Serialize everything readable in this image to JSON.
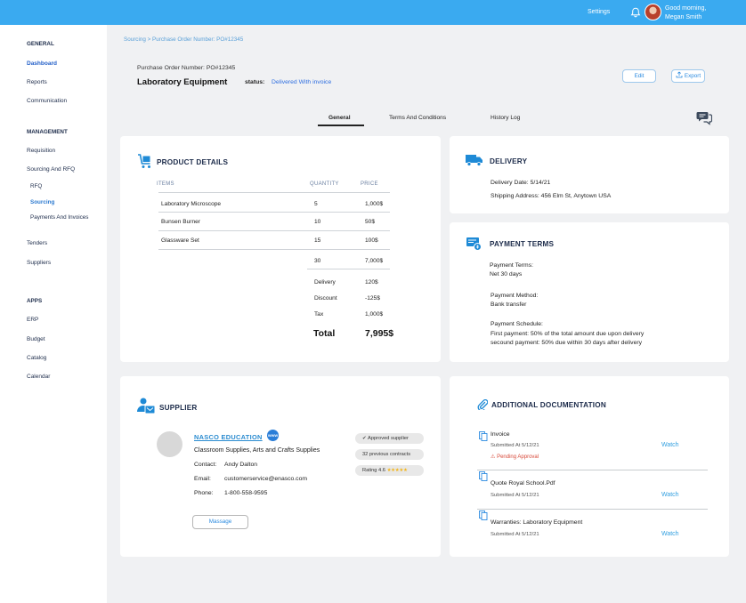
{
  "header": {
    "settings": "Settings",
    "greeting_line1": "Good morning,",
    "greeting_line2": "Megan Smith"
  },
  "sidebar": {
    "general": "GENERAL",
    "dashboard": "Dashboard",
    "reports": "Reports",
    "communication": "Communication",
    "management": "MANAGEMENT",
    "requisition": "Requisition",
    "sourcing_rfq": "Sourcing And RFQ",
    "rfq": "RFQ",
    "sourcing": "Sourcing",
    "payments": "Payments And Invoices",
    "tenders": "Tenders",
    "suppliers": "Suppliers",
    "apps": "APPS",
    "erp": "ERP",
    "budget": "Budget",
    "catalog": "Catalog",
    "calendar": "Calendar"
  },
  "breadcrumb": "Sourcing >  Purchase Order Number: PO#12345",
  "po_label": "Purchase Order Number: PO#12345",
  "title": "Laboratory Equipment",
  "status_label": "status:",
  "status_value": "Delivered With invoice",
  "buttons": {
    "edit": "Edit",
    "export": "Export",
    "message": "Massage"
  },
  "tabs": [
    "General",
    "Terms And Conditions",
    "History Log"
  ],
  "product": {
    "title": "PRODUCT DETAILS",
    "headers": [
      "ITEMS",
      "QUANTITY",
      "PRICE"
    ],
    "rows": [
      [
        "Laboratory Microscope",
        "5",
        "1,000$"
      ],
      [
        "Bunsen Burner",
        "10",
        "50$"
      ],
      [
        "Glassware Set",
        "15",
        "100$"
      ]
    ],
    "subtotal_qty": "30",
    "subtotal_price": "7,000$",
    "delivery_label": "Delivery",
    "delivery_val": "120$",
    "discount_label": "Discount",
    "discount_val": "-125$",
    "tax_label": "Tax",
    "tax_val": "1,000$",
    "total_label": "Total",
    "total_val": "7,995$"
  },
  "delivery": {
    "title": "DELIVERY",
    "date": "Delivery Date: 5/14/21",
    "address": "Shipping Address: 456 Elm St, Anytown USA"
  },
  "payment": {
    "title": "PAYMENT TERMS",
    "terms_label": "Payment Terms:",
    "terms_val": "Net 30 days",
    "method_label": "Payment Method:",
    "method_val": "Bank transfer",
    "schedule_label": "Payment Schedule:",
    "schedule_1": "First payment:  50% of the total amount due upon delivery",
    "schedule_2": "secound payment:  50% due within 30 days after delivery"
  },
  "supplier": {
    "title": "SUPPLIER",
    "name": "NASCO EDUCATION",
    "www": "WWW",
    "desc": "Classroom Supplies, Arts and Crafts Supplies",
    "contact_label": "Contact:",
    "contact": "Andy Dalton",
    "email_label": "Email:",
    "email": "customerservice@enasco.com",
    "phone_label": "Phone:",
    "phone": "1-800-558-9595",
    "approved": "Approved supplier",
    "contracts": "32 previous contracts",
    "rating_label": "Rating",
    "rating_value": "4.6",
    "rating_stars": "★★★★★"
  },
  "docs": {
    "title": "ADDITIONAL DOCUMENTATION",
    "items": [
      {
        "name": "Invoice",
        "submitted": "Submitted At 5/12/21",
        "action": "Watch"
      },
      {
        "name": "Quote Royal School.Pdf",
        "submitted": "Submitted At 5/12/21",
        "action": "Watch"
      },
      {
        "name": "Warranties:  Laboratory Equipment",
        "submitted": "Submitted At 5/12/21",
        "action": "Watch"
      }
    ],
    "pending": "Pending Approval"
  },
  "colors": {
    "topbar": "#3aaaf0",
    "accent": "#2c8be0",
    "status": "#2e6ee0",
    "warning": "#d84a3a"
  }
}
